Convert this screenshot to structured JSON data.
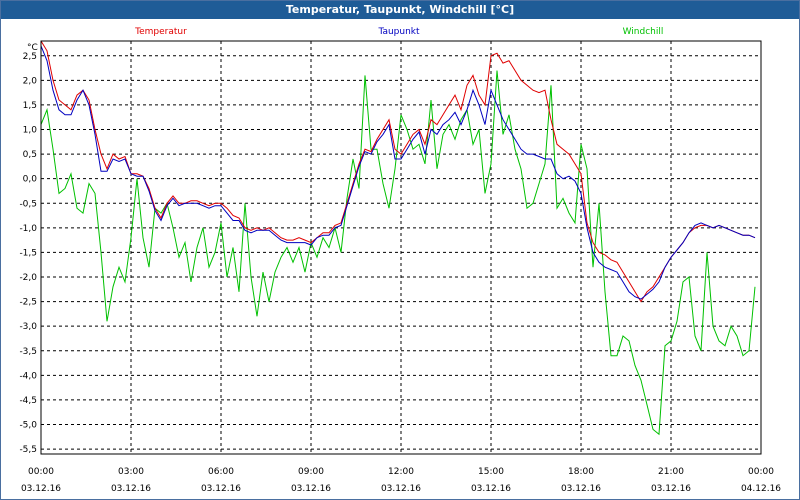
{
  "window": {
    "title": "Temperatur, Taupunkt, Windchill [°C]"
  },
  "chart_data": {
    "type": "line",
    "title": "Temperatur, Taupunkt, Windchill [°C]",
    "ylabel": "°C",
    "ylim": [
      -5.6,
      2.8
    ],
    "yticks": [
      2.5,
      2.0,
      1.5,
      1.0,
      0.5,
      0.0,
      -0.5,
      -1.0,
      -1.5,
      -2.0,
      -2.5,
      -3.0,
      -3.5,
      -4.0,
      -4.5,
      -5.0,
      -5.5
    ],
    "ytick_labels": [
      "2,5",
      "2,0",
      "1,5",
      "1,0",
      "0,5",
      "0,0",
      "-0,5",
      "-1,0",
      "-1,5",
      "-2,0",
      "-2,5",
      "-3,0",
      "-3,5",
      "-4,0",
      "-4,5",
      "-5,0",
      "-5,5"
    ],
    "xlim": [
      0,
      24
    ],
    "xticks": [
      0,
      3,
      6,
      9,
      12,
      15,
      18,
      21,
      24
    ],
    "xtick_time_labels": [
      "00:00",
      "03:00",
      "06:00",
      "09:00",
      "12:00",
      "15:00",
      "18:00",
      "21:00",
      "00:00"
    ],
    "xtick_date_labels": [
      "03.12.16",
      "03.12.16",
      "03.12.16",
      "03.12.16",
      "03.12.16",
      "03.12.16",
      "03.12.16",
      "03.12.16",
      "04.12.16"
    ],
    "grid": true,
    "legend_placement": "top",
    "series": [
      {
        "name": "Temperatur",
        "color": "#e00000",
        "x": [
          0,
          0.2,
          0.4,
          0.6,
          0.8,
          1.0,
          1.2,
          1.4,
          1.6,
          1.8,
          2.0,
          2.2,
          2.4,
          2.6,
          2.8,
          3.0,
          3.2,
          3.4,
          3.6,
          3.8,
          4.0,
          4.2,
          4.4,
          4.6,
          4.8,
          5.0,
          5.2,
          5.4,
          5.6,
          5.8,
          6.0,
          6.2,
          6.4,
          6.6,
          6.8,
          7.0,
          7.2,
          7.4,
          7.6,
          7.8,
          8.0,
          8.2,
          8.4,
          8.6,
          8.8,
          9.0,
          9.2,
          9.4,
          9.6,
          9.8,
          10.0,
          10.2,
          10.4,
          10.6,
          10.8,
          11.0,
          11.2,
          11.4,
          11.6,
          11.8,
          12.0,
          12.2,
          12.4,
          12.6,
          12.8,
          13.0,
          13.2,
          13.4,
          13.6,
          13.8,
          14.0,
          14.2,
          14.4,
          14.6,
          14.8,
          15.0,
          15.2,
          15.4,
          15.6,
          15.8,
          16.0,
          16.2,
          16.4,
          16.6,
          16.8,
          17.0,
          17.2,
          17.4,
          17.6,
          17.8,
          18.0,
          18.2,
          18.4,
          18.6,
          18.8,
          19.0,
          19.2,
          19.4,
          19.6,
          19.8,
          20.0,
          20.2,
          20.4,
          20.6,
          20.8,
          21.0,
          21.2,
          21.4,
          21.6,
          21.8,
          22.0,
          22.2,
          22.4,
          22.6,
          22.8,
          23.0,
          23.2,
          23.4,
          23.6,
          23.8
        ],
        "values": [
          2.8,
          2.6,
          2.0,
          1.6,
          1.5,
          1.4,
          1.7,
          1.8,
          1.6,
          1.0,
          0.5,
          0.2,
          0.5,
          0.4,
          0.45,
          0.1,
          0.1,
          0.05,
          -0.2,
          -0.6,
          -0.8,
          -0.5,
          -0.35,
          -0.5,
          -0.5,
          -0.45,
          -0.45,
          -0.5,
          -0.55,
          -0.5,
          -0.5,
          -0.6,
          -0.75,
          -0.8,
          -1.0,
          -1.05,
          -1.0,
          -1.05,
          -1.0,
          -1.1,
          -1.2,
          -1.25,
          -1.25,
          -1.2,
          -1.25,
          -1.3,
          -1.2,
          -1.1,
          -1.1,
          -0.95,
          -0.9,
          -0.5,
          -0.1,
          0.3,
          0.6,
          0.55,
          0.8,
          1.0,
          1.2,
          0.6,
          0.5,
          0.7,
          0.9,
          1.0,
          0.7,
          1.2,
          1.1,
          1.3,
          1.5,
          1.7,
          1.4,
          1.9,
          2.1,
          1.7,
          1.5,
          2.5,
          2.55,
          2.35,
          2.4,
          2.2,
          2.0,
          1.9,
          1.8,
          1.75,
          1.8,
          1.2,
          0.7,
          0.6,
          0.5,
          0.3,
          0.1,
          -0.9,
          -1.3,
          -1.5,
          -1.55,
          -1.65,
          -1.7,
          -1.9,
          -2.1,
          -2.3,
          -2.5,
          -2.3,
          -2.2,
          -2.0,
          -1.8,
          -1.6,
          -1.45,
          -1.3,
          -1.1,
          -1.0,
          -0.95,
          -0.95,
          -1.0,
          -0.95,
          -1.0,
          -1.05,
          -1.1,
          -1.15,
          -1.15,
          -1.2
        ]
      },
      {
        "name": "Taupunkt",
        "color": "#0000c0",
        "x": [
          0,
          0.2,
          0.4,
          0.6,
          0.8,
          1.0,
          1.2,
          1.4,
          1.6,
          1.8,
          2.0,
          2.2,
          2.4,
          2.6,
          2.8,
          3.0,
          3.2,
          3.4,
          3.6,
          3.8,
          4.0,
          4.2,
          4.4,
          4.6,
          4.8,
          5.0,
          5.2,
          5.4,
          5.6,
          5.8,
          6.0,
          6.2,
          6.4,
          6.6,
          6.8,
          7.0,
          7.2,
          7.4,
          7.6,
          7.8,
          8.0,
          8.2,
          8.4,
          8.6,
          8.8,
          9.0,
          9.2,
          9.4,
          9.6,
          9.8,
          10.0,
          10.2,
          10.4,
          10.6,
          10.8,
          11.0,
          11.2,
          11.4,
          11.6,
          11.8,
          12.0,
          12.2,
          12.4,
          12.6,
          12.8,
          13.0,
          13.2,
          13.4,
          13.6,
          13.8,
          14.0,
          14.2,
          14.4,
          14.6,
          14.8,
          15.0,
          15.2,
          15.4,
          15.6,
          15.8,
          16.0,
          16.2,
          16.4,
          16.6,
          16.8,
          17.0,
          17.2,
          17.4,
          17.6,
          17.8,
          18.0,
          18.2,
          18.4,
          18.6,
          18.8,
          19.0,
          19.2,
          19.4,
          19.6,
          19.8,
          20.0,
          20.2,
          20.4,
          20.6,
          20.8,
          21.0,
          21.2,
          21.4,
          21.6,
          21.8,
          22.0,
          22.2,
          22.4,
          22.6,
          22.8,
          23.0,
          23.2,
          23.4,
          23.6,
          23.8
        ],
        "values": [
          2.7,
          2.4,
          1.8,
          1.4,
          1.3,
          1.3,
          1.6,
          1.8,
          1.5,
          0.9,
          0.15,
          0.15,
          0.4,
          0.35,
          0.4,
          0.1,
          0.05,
          0.05,
          -0.25,
          -0.65,
          -0.85,
          -0.55,
          -0.4,
          -0.55,
          -0.5,
          -0.5,
          -0.5,
          -0.55,
          -0.6,
          -0.55,
          -0.55,
          -0.7,
          -0.85,
          -0.85,
          -1.05,
          -1.1,
          -1.05,
          -1.05,
          -1.05,
          -1.15,
          -1.25,
          -1.3,
          -1.3,
          -1.3,
          -1.3,
          -1.35,
          -1.2,
          -1.15,
          -1.15,
          -1.0,
          -0.95,
          -0.55,
          -0.15,
          0.25,
          0.55,
          0.5,
          0.75,
          0.9,
          1.1,
          0.4,
          0.4,
          0.6,
          0.8,
          0.95,
          0.5,
          1.0,
          0.9,
          1.1,
          1.2,
          1.35,
          1.1,
          1.4,
          1.8,
          1.5,
          1.1,
          1.8,
          1.5,
          1.2,
          1.0,
          0.8,
          0.6,
          0.5,
          0.5,
          0.45,
          0.4,
          0.4,
          0.1,
          0.0,
          0.05,
          -0.05,
          -0.3,
          -1.0,
          -1.5,
          -1.7,
          -1.8,
          -1.85,
          -1.9,
          -2.1,
          -2.3,
          -2.4,
          -2.45,
          -2.35,
          -2.25,
          -2.1,
          -1.8,
          -1.6,
          -1.45,
          -1.3,
          -1.1,
          -0.95,
          -0.9,
          -0.95,
          -1.0,
          -0.95,
          -1.0,
          -1.05,
          -1.1,
          -1.15,
          -1.15,
          -1.2
        ]
      },
      {
        "name": "Windchill",
        "color": "#00c000",
        "x": [
          0,
          0.2,
          0.4,
          0.6,
          0.8,
          1.0,
          1.2,
          1.4,
          1.6,
          1.8,
          2.0,
          2.2,
          2.4,
          2.6,
          2.8,
          3.0,
          3.2,
          3.4,
          3.6,
          3.8,
          4.0,
          4.2,
          4.4,
          4.6,
          4.8,
          5.0,
          5.2,
          5.4,
          5.6,
          5.8,
          6.0,
          6.2,
          6.4,
          6.6,
          6.8,
          7.0,
          7.2,
          7.4,
          7.6,
          7.8,
          8.0,
          8.2,
          8.4,
          8.6,
          8.8,
          9.0,
          9.2,
          9.4,
          9.6,
          9.8,
          10.0,
          10.2,
          10.4,
          10.6,
          10.8,
          11.0,
          11.2,
          11.4,
          11.6,
          11.8,
          12.0,
          12.2,
          12.4,
          12.6,
          12.8,
          13.0,
          13.2,
          13.4,
          13.6,
          13.8,
          14.0,
          14.2,
          14.4,
          14.6,
          14.8,
          15.0,
          15.2,
          15.4,
          15.6,
          15.8,
          16.0,
          16.2,
          16.4,
          16.6,
          16.8,
          17.0,
          17.2,
          17.4,
          17.6,
          17.8,
          18.0,
          18.2,
          18.4,
          18.6,
          18.8,
          19.0,
          19.2,
          19.4,
          19.6,
          19.8,
          20.0,
          20.2,
          20.4,
          20.6,
          20.8,
          21.0,
          21.2,
          21.4,
          21.6,
          21.8,
          22.0,
          22.2,
          22.4,
          22.6,
          22.8,
          23.0,
          23.2,
          23.4,
          23.6,
          23.8
        ],
        "values": [
          1.1,
          1.4,
          0.6,
          -0.3,
          -0.2,
          0.1,
          -0.6,
          -0.7,
          -0.1,
          -0.3,
          -1.5,
          -2.9,
          -2.2,
          -1.8,
          -2.1,
          -1.2,
          0.0,
          -1.2,
          -1.8,
          -0.6,
          -0.7,
          -0.5,
          -1.0,
          -1.6,
          -1.3,
          -2.1,
          -1.4,
          -1.0,
          -1.8,
          -1.5,
          -0.9,
          -2.0,
          -1.4,
          -2.3,
          -0.5,
          -2.0,
          -2.8,
          -1.9,
          -2.5,
          -1.9,
          -1.6,
          -1.4,
          -1.7,
          -1.4,
          -1.9,
          -1.3,
          -1.6,
          -1.2,
          -1.4,
          -1.0,
          -1.5,
          -0.4,
          0.4,
          -0.2,
          2.1,
          0.6,
          0.6,
          -0.1,
          -0.6,
          0.2,
          1.3,
          1.0,
          0.6,
          0.7,
          0.3,
          1.6,
          0.2,
          0.9,
          1.1,
          0.8,
          1.2,
          1.4,
          0.7,
          1.0,
          -0.3,
          0.3,
          2.2,
          0.9,
          1.3,
          0.6,
          0.2,
          -0.6,
          -0.5,
          -0.1,
          0.3,
          1.9,
          -0.6,
          -0.4,
          -0.7,
          -0.9,
          0.7,
          0.2,
          -1.8,
          -0.5,
          -2.3,
          -3.6,
          -3.6,
          -3.2,
          -3.3,
          -3.8,
          -4.1,
          -4.6,
          -5.1,
          -5.2,
          -3.4,
          -3.3,
          -2.9,
          -2.1,
          -2.0,
          -3.2,
          -3.5,
          -1.5,
          -3.0,
          -3.3,
          -3.4,
          -3.0,
          -3.2,
          -3.6,
          -3.5,
          -2.2
        ]
      }
    ]
  }
}
